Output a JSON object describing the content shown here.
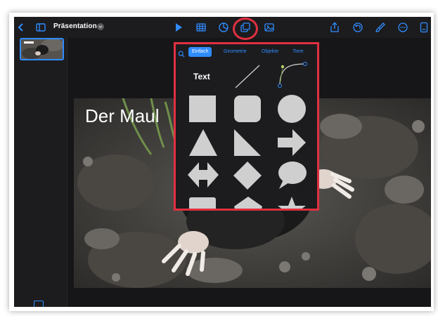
{
  "toolbar": {
    "back_icon": "chevron-left-icon",
    "sidebar_icon": "sidebar-icon",
    "title": "Präsentation",
    "title_menu_icon": "chevron-down-icon",
    "play_icon": "play-icon",
    "table_icon": "table-icon",
    "chart_icon": "chart-icon",
    "shapes_icon": "shapes-icon",
    "media_icon": "media-icon",
    "share_icon": "share-icon",
    "undo_icon": "undo-icon",
    "format_icon": "paintbrush-icon",
    "more_icon": "more-icon",
    "doc_icon": "document-icon",
    "accent": "#2f8cff"
  },
  "slide": {
    "title": "Der Maul"
  },
  "shape_popover": {
    "search_icon": "search-icon",
    "tabs": [
      {
        "label": "Einfach",
        "active": true
      },
      {
        "label": "Geometrie",
        "active": false
      },
      {
        "label": "Objekte",
        "active": false
      },
      {
        "label": "Tiere",
        "active": false
      }
    ],
    "text_item": "Text",
    "highlight_color": "#e03040"
  }
}
